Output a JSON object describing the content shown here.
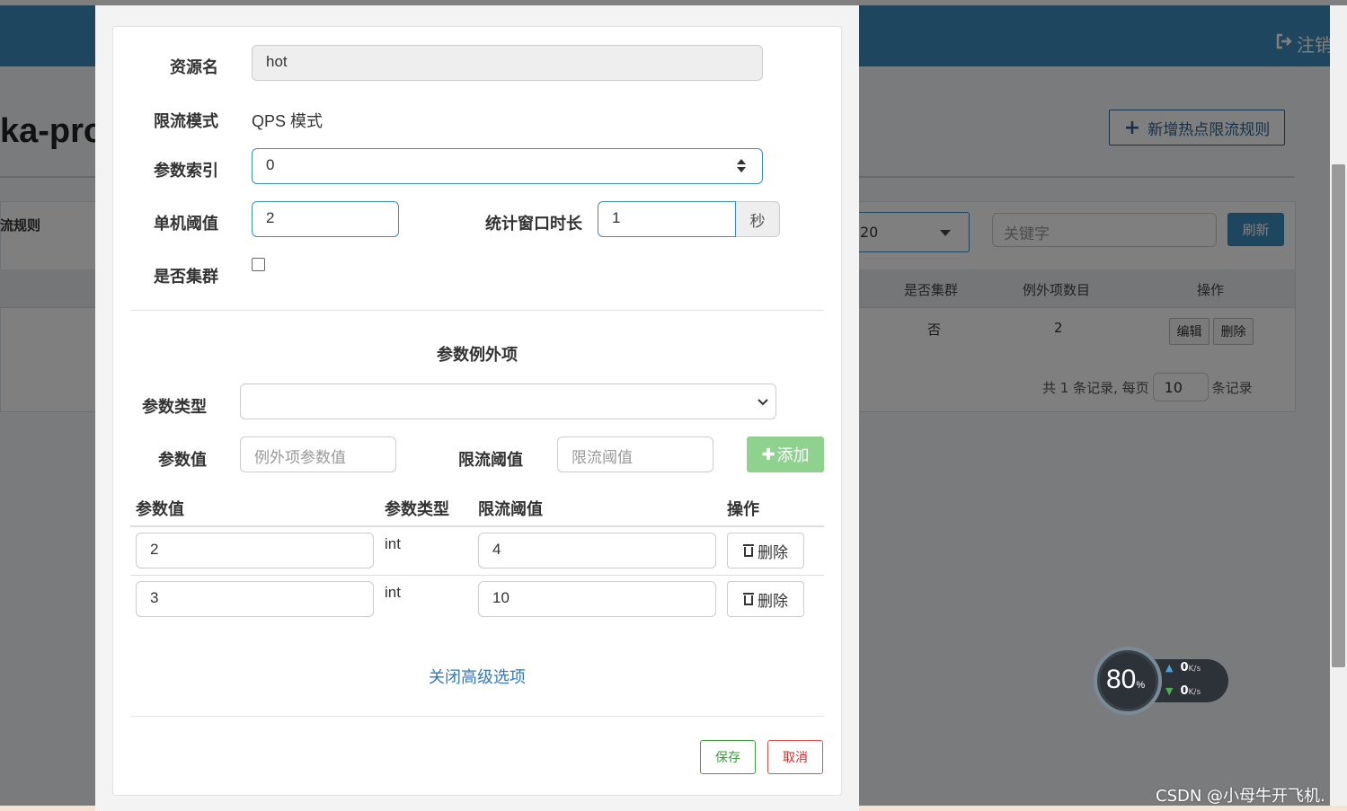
{
  "background": {
    "logout_label": "注销",
    "logout_icon": "sign-out-icon",
    "app_title_fragment": "ka-pro",
    "add_rule_label": "新增热点限流规则",
    "panel_title_fragment": "流规则",
    "page_size_value": "20",
    "search_placeholder": "关键字",
    "refresh_label": "刷新",
    "table": {
      "headers": [
        "是否集群",
        "例外项数目",
        "操作"
      ],
      "row": {
        "cluster": "否",
        "exception_count": "2",
        "edit_label": "编辑",
        "delete_label": "删除"
      }
    },
    "pager": {
      "prefix": "共 1 条记录, 每页",
      "page_size": "10",
      "suffix": "条记录"
    }
  },
  "widget": {
    "percent": "80",
    "percent_unit": "%",
    "upload_speed": "0",
    "download_speed": "0",
    "speed_unit": "K/s"
  },
  "watermark": "CSDN @小母牛开飞机.",
  "modal": {
    "resource_label": "资源名",
    "resource_value": "hot",
    "mode_label": "限流模式",
    "mode_value": "QPS 模式",
    "param_index_label": "参数索引",
    "param_index_value": "0",
    "threshold_label": "单机阈值",
    "threshold_value": "2",
    "window_label": "统计窗口时长",
    "window_value": "1",
    "window_unit": "秒",
    "cluster_label": "是否集群",
    "cluster_checked": false,
    "exceptions_title": "参数例外项",
    "param_type_label": "参数类型",
    "param_type_value": "",
    "param_value_label": "参数值",
    "param_value_placeholder": "例外项参数值",
    "limit_label": "限流阈值",
    "limit_placeholder": "限流阈值",
    "add_label": "添加",
    "table": {
      "headers": [
        "参数值",
        "参数类型",
        "限流阈值",
        "操作"
      ],
      "rows": [
        {
          "value": "2",
          "type": "int",
          "limit": "4",
          "delete_label": "删除"
        },
        {
          "value": "3",
          "type": "int",
          "limit": "10",
          "delete_label": "删除"
        }
      ]
    },
    "close_advanced_label": "关闭高级选项",
    "save_label": "保存",
    "cancel_label": "取消"
  }
}
